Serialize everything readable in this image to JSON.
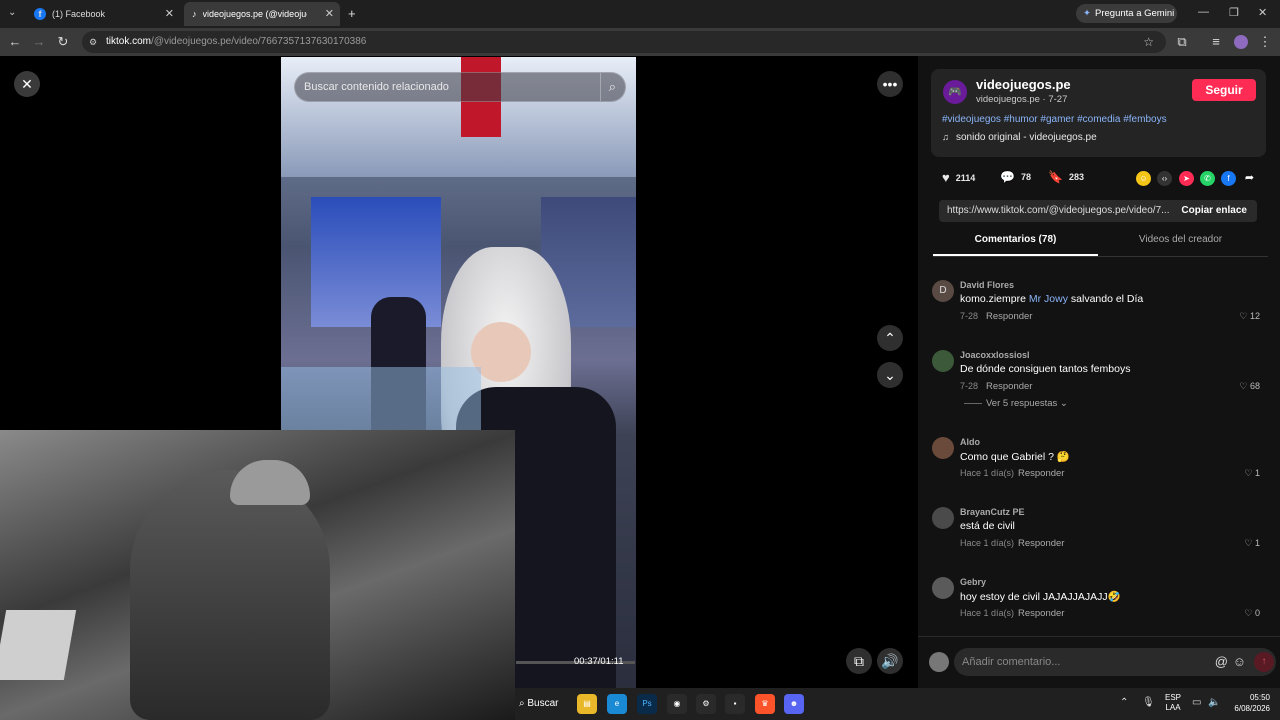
{
  "tabs": [
    {
      "label": "(1) Facebook"
    },
    {
      "label": "videojuegos.pe (@videojue"
    }
  ],
  "gemini_label": "Pregunta a Gemini",
  "url": {
    "domain": "tiktok.com",
    "path": "/@videojuegos.pe/video/7667357137630170386"
  },
  "video": {
    "search_placeholder": "Buscar contenido relacionado",
    "time": "00:37/01:11"
  },
  "post": {
    "author": "videojuegos.pe",
    "handle_date": "videojuegos.pe · 7-27",
    "follow": "Seguir",
    "tags": "#videojuegos #humor #gamer #comedia #femboys",
    "sound": "sonido original - videojuegos.pe",
    "likes": "2114",
    "comments": "78",
    "saves": "283",
    "link": "https://www.tiktok.com/@videojuegos.pe/video/7...",
    "copy": "Copiar enlace"
  },
  "sections": {
    "comments_tab": "Comentarios (78)",
    "videos_tab": "Videos del creador"
  },
  "comments": [
    {
      "name": "David Flores",
      "avatar": "D",
      "text_a": "komo.ziempre",
      "mention": "Mr Jowy",
      "text_b": "salvando el Día",
      "time": "7-28",
      "reply": "Responder",
      "likes": "12"
    },
    {
      "name": "Joacoxxlossiosl",
      "text": "De dónde consiguen tantos femboys",
      "time": "7-28",
      "reply": "Responder",
      "likes": "68",
      "replies": "Ver 5 respuestas"
    },
    {
      "name": "Aldo",
      "text": "Como que Gabriel ? 🤔",
      "time": "Hace 1 día(s)",
      "reply": "Responder",
      "likes": "1"
    },
    {
      "name": "BrayanCutz PE",
      "text": "está de civil",
      "time": "Hace 1 día(s)",
      "reply": "Responder",
      "likes": "1"
    },
    {
      "name": "Gebry",
      "text": "hoy estoy de civil JAJAJJAJAJJ🤣",
      "time": "Hace 1 día(s)",
      "reply": "Responder",
      "likes": "0"
    }
  ],
  "comment_input": "Añadir comentario...",
  "taskbar": {
    "search": "Buscar",
    "lang": "ESP",
    "layout": "LAA",
    "time": "05:50",
    "date": "6/08/2026"
  }
}
